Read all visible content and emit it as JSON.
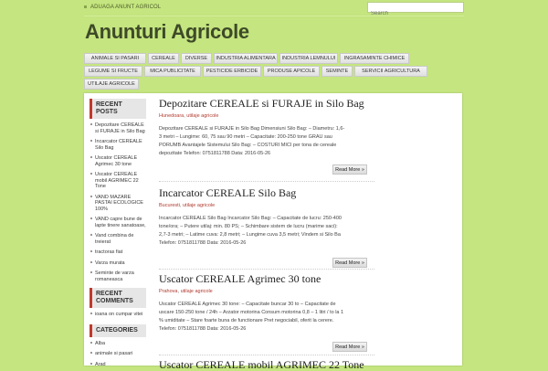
{
  "topbar": {
    "link": "ADUAGA ANUNT AGRICOL",
    "search_placeholder": "Search"
  },
  "site": {
    "title": "Anunturi Agricole"
  },
  "nav": {
    "row1": [
      "ANIMALE SI PASARI",
      "CEREALE",
      "DIVERSE",
      "INDUSTRIA ALIMENTARA",
      "INDUSTRIA LEMNULUI",
      "INGRASAMINTE CHIMICE"
    ],
    "row2": [
      "LEGUME SI FRUCTE",
      "MICA PUBLICITATE",
      "PESTICIDE ERBICIDE",
      "PRODUSE APICOLE",
      "SEMINTE",
      "SERVICII AGRICULTURA"
    ],
    "row3": [
      "UTILAJE AGRICOLE"
    ]
  },
  "sidebar": {
    "recent_posts": {
      "title": "RECENT POSTS",
      "items": [
        "Depozitare CEREALE si FURAJE in Silo Bag",
        "Incarcator CEREALE Silo Bag",
        "Uscator CEREALE Agrimec 30 tone",
        "Uscator CEREALE mobil AGRIMEC 22 Tone",
        "VAND MAZARE PASTAI ECOLOGICE 100%",
        "VAND capre bune de lapte tinere sanatoase,",
        "Vand combina de treierat",
        "tractoras fiat",
        "Varza murata",
        "Seminte de varza romaneasca"
      ]
    },
    "recent_comments": {
      "title": "RECENT COMMENTS",
      "items": [
        "ioana on cumpar vitei"
      ]
    },
    "categories": {
      "title": "CATEGORIES",
      "items": [
        "Alba",
        "animale si pasari",
        "Arad"
      ]
    }
  },
  "posts": [
    {
      "title": "Depozitare CEREALE si FURAJE in Silo Bag",
      "location": "Hunedoara",
      "category": "utilaje agricole",
      "excerpt": "Depozitare CEREALE si FURAJE in Silo Bag Dimensiuni Silo Bag: – Diametru: 1,6-3 metri – Lungime: 60, 75 sau 90 metri – Capacitate: 200-250 tone GRAU sau PORUMB Avantajele Sistemului Silo Bag: – COSTURI MICI per tona de cereale depozitate Telefon: 0751811788 Data: 2016-05-26",
      "readmore": "Read More »"
    },
    {
      "title": "Incarcator CEREALE Silo Bag",
      "location": "Bucuresti",
      "category": "utilaje agricole",
      "excerpt": "Incarcator CEREALE Silo Bag Incarcator Silo Bag: – Capacitate de lucru: 250-400 tone/ora; – Putere utilaj: min. 80 PS; – Schimbare sistem de lucru (marime saci): 2,7-3 metri; – Latime cuva: 2,8 metri; – Lungime cuva 3,5 metri; Vindem si Silo Ba Telefon: 0751811788 Data: 2016-05-26",
      "readmore": "Read More »"
    },
    {
      "title": "Uscator CEREALE Agrimec 30 tone",
      "location": "Prahova",
      "category": "utilaje agricole",
      "excerpt": "Uscator CEREALE Agrimec 30 tone: – Capacitate buncar 30 to – Capacitate de uscare 150-250 tone / 24h – Arzator motorina Consum motorina 0,8 – 1 litri / to la 1 % umiditate – Stare foarte buna de functionare Pret negociabil, oferit la cerere. Telefon: 0751811788 Data: 2016-05-26",
      "readmore": "Read More »"
    },
    {
      "title": "Uscator CEREALE mobil AGRIMEC 22 Tone",
      "location": "",
      "category": "",
      "excerpt": "",
      "readmore": ""
    }
  ]
}
